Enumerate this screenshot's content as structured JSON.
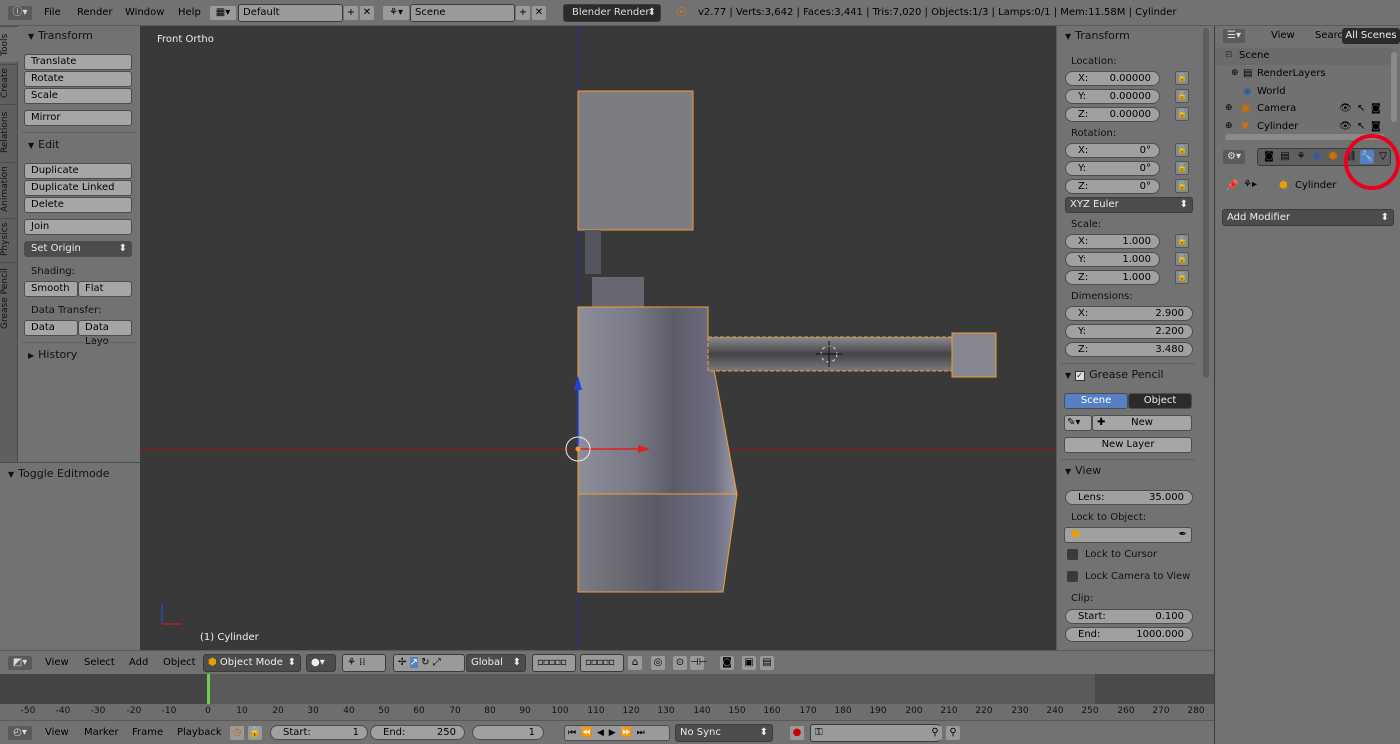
{
  "topbar": {
    "menus": [
      "File",
      "Render",
      "Window",
      "Help"
    ],
    "layout": "Default",
    "scene": "Scene",
    "engine": "Blender Render",
    "stats": "v2.77 | Verts:3,642 | Faces:3,441 | Tris:7,020 | Objects:1/3 | Lamps:0/1 | Mem:11.58M | Cylinder"
  },
  "toolshelf": {
    "tabs": [
      "Tools",
      "Create",
      "Relations",
      "Animation",
      "Physics",
      "Grease Pencil"
    ],
    "transform_header": "Transform",
    "translate": "Translate",
    "rotate": "Rotate",
    "scale": "Scale",
    "mirror": "Mirror",
    "edit_header": "Edit",
    "duplicate": "Duplicate",
    "duplicate_linked": "Duplicate Linked",
    "delete": "Delete",
    "join": "Join",
    "set_origin": "Set Origin",
    "shading_label": "Shading:",
    "smooth": "Smooth",
    "flat": "Flat",
    "data_transfer_label": "Data Transfer:",
    "data": "Data",
    "data_layo": "Data Layo",
    "history": "History",
    "toggle_editmode": "Toggle Editmode"
  },
  "viewport": {
    "view_label": "Front Ortho",
    "object_label": "(1) Cylinder"
  },
  "npanel": {
    "transform_header": "Transform",
    "location_label": "Location:",
    "location": {
      "x": "0.00000",
      "y": "0.00000",
      "z": "0.00000"
    },
    "rotation_label": "Rotation:",
    "rotation": {
      "x": "0°",
      "y": "0°",
      "z": "0°"
    },
    "rotation_mode": "XYZ Euler",
    "scale_label": "Scale:",
    "scale": {
      "x": "1.000",
      "y": "1.000",
      "z": "1.000"
    },
    "dimensions_label": "Dimensions:",
    "dimensions": {
      "x": "2.900",
      "y": "2.200",
      "z": "3.480"
    },
    "axis_x": "X:",
    "axis_y": "Y:",
    "axis_z": "Z:",
    "grease_header": "Grease Pencil",
    "gp_scene": "Scene",
    "gp_object": "Object",
    "gp_new": "New",
    "gp_new_layer": "New Layer",
    "view_header": "View",
    "lens_label": "Lens:",
    "lens_value": "35.000",
    "lock_to_object": "Lock to Object:",
    "lock_to_cursor": "Lock to Cursor",
    "lock_camera": "Lock Camera to View",
    "clip_label": "Clip:",
    "clip_start_label": "Start:",
    "clip_start": "0.100",
    "clip_end_label": "End:",
    "clip_end": "1000.000"
  },
  "outliner": {
    "view": "View",
    "search": "Search",
    "filter": "All Scenes",
    "items": [
      "Scene",
      "RenderLayers",
      "World",
      "Camera",
      "Cylinder"
    ]
  },
  "properties": {
    "object_name": "Cylinder",
    "add_modifier": "Add Modifier"
  },
  "vp_header": {
    "view": "View",
    "select": "Select",
    "add": "Add",
    "object": "Object",
    "mode": "Object Mode",
    "orientation": "Global"
  },
  "timeline": {
    "ticks": [
      "-50",
      "-40",
      "-30",
      "-20",
      "-10",
      "0",
      "10",
      "20",
      "30",
      "40",
      "50",
      "60",
      "70",
      "80",
      "90",
      "100",
      "110",
      "120",
      "130",
      "140",
      "150",
      "160",
      "170",
      "180",
      "190",
      "200",
      "210",
      "220",
      "230",
      "240",
      "250",
      "260",
      "270",
      "280"
    ],
    "current_frame": "0"
  },
  "tl_header": {
    "view": "View",
    "marker": "Marker",
    "frame": "Frame",
    "playback": "Playback",
    "start_label": "Start:",
    "start": "1",
    "end_label": "End:",
    "end": "250",
    "current": "1",
    "sync": "No Sync"
  },
  "colors": {
    "accent_blue": "#5680c2",
    "selection_orange": "#f5a623",
    "highlight_red": "#e8001c"
  }
}
